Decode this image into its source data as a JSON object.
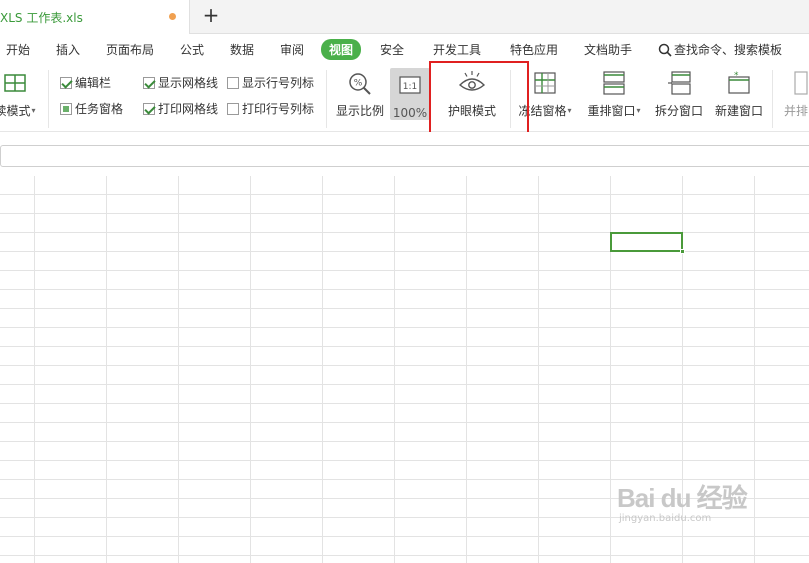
{
  "tab": {
    "title": "XLS 工作表.xls",
    "new_tab": "+"
  },
  "menu": {
    "items": [
      "开始",
      "插入",
      "页面布局",
      "公式",
      "数据",
      "审阅",
      "视图",
      "安全",
      "开发工具",
      "特色应用",
      "文档助手"
    ],
    "active": "视图",
    "search": "查找命令、搜索模板"
  },
  "ribbon": {
    "read_mode": "读模式",
    "edit_bar": "编辑栏",
    "task_pane": "任务窗格",
    "show_gridlines": "显示网格线",
    "print_gridlines": "打印网格线",
    "show_headings": "显示行号列标",
    "print_headings": "打印行号列标",
    "zoom_ratio": "显示比例",
    "zoom_value": "100%",
    "zoom_icon_text": "1:1",
    "eye_mode": "护眼模式",
    "freeze": "冻结窗格",
    "arrange": "重排窗口",
    "split": "拆分窗口",
    "new_window": "新建窗口",
    "side_by_side": "并排"
  },
  "colors": {
    "accent": "#4ab04a",
    "highlight": "#e02020",
    "selection": "#4a9a3a",
    "grid": "#e3e3e3"
  },
  "watermark": {
    "logo": "Bai du 经验",
    "url": "jingyan.baidu.com"
  }
}
